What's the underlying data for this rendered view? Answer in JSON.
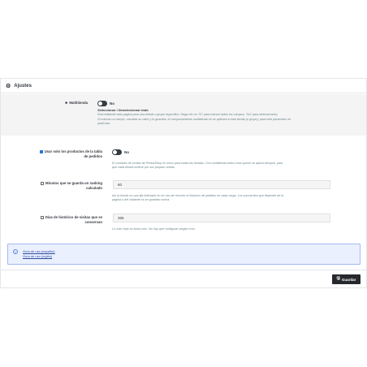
{
  "panel": {
    "title": "Ajustes"
  },
  "multitienda": {
    "label": "Multitienda",
    "toggle_value": "No",
    "select_text": "Seleccionar / Deseleccionar todo",
    "help_line1": "Está editando esta página para una tienda o grupo específico. Haga clic en \"Sí\" para marcar todos los campos, \"No\" para desmarcarlos.",
    "help_line2": "Si marcas un campo, cambias su valor y lo guardas, el comportamiento multitienda no se aplicará a esta tienda (o grupo), para este parámetro en",
    "help_line3": "particular."
  },
  "fields": {
    "solo_productos": {
      "label_line1": "Usar solo los productos de la tabla",
      "label_line2": "de pedidos",
      "checked": true,
      "toggle_value": "No",
      "help_line1": "El contador de ventas de PrestaShop es único para todas las tiendas. Con multitienda activo esta opción se aplica siempre, para",
      "help_line2": "que cada tienda ordene por sus propias ventas."
    },
    "minutos_ranking": {
      "label_line1": "Minutos que se guarda un ranking",
      "label_line2": "calculado",
      "checked": false,
      "value": "60",
      "help_line1": "Así la tienda no una fija indexado en en vez de recorrer el histórico de pedidos en cada carga. Los sumuentes que depende de la",
      "help_line2": "página o del visitante no se guardan nunca."
    },
    "dias_historico": {
      "label_line1": "Días de histórico de visitas que se",
      "label_line2": "conservan",
      "checked": false,
      "value": "365",
      "help_line1": "Lo más viejo se borra solo. No hay que configurar ningún cron."
    }
  },
  "info": {
    "link1": "Guía de uso (español)",
    "link2": "Guía de uso (inglés)"
  },
  "footer": {
    "save_label": "Guardar"
  },
  "colors": {
    "toggle_off": "#363a41",
    "primary_dark": "#25282d",
    "info_bg": "#ebf0ff",
    "info_border": "#a5b7f0",
    "checkbox_checked": "#2a73d9"
  }
}
